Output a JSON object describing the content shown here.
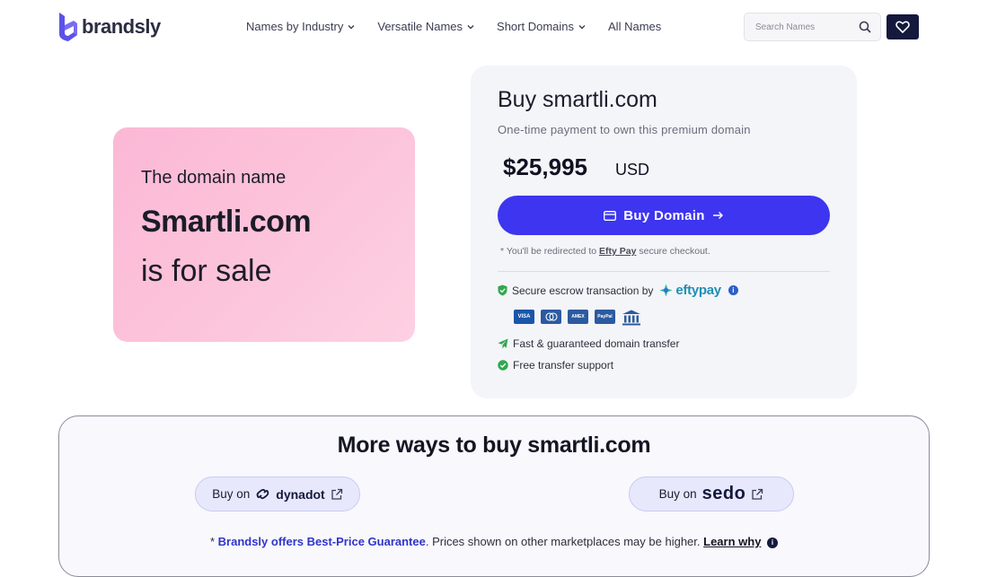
{
  "header": {
    "logo_text": "brandsly",
    "nav": [
      {
        "label": "Names by Industry",
        "has_dropdown": true
      },
      {
        "label": "Versatile Names",
        "has_dropdown": true
      },
      {
        "label": "Short Domains",
        "has_dropdown": true
      },
      {
        "label": "All Names",
        "has_dropdown": false
      }
    ],
    "search_placeholder": "Search Names",
    "icons": {
      "search": "search-icon",
      "favorites": "heart-icon"
    }
  },
  "sale_card": {
    "line1": "The domain name",
    "domain": "Smartli.com",
    "line3": "is for sale"
  },
  "buy_panel": {
    "title": "Buy smartli.com",
    "subtitle": "One-time payment to own this premium domain",
    "price": "$25,995",
    "currency": "USD",
    "buy_button": "Buy Domain",
    "redirect_prefix": "* You'll be redirected to",
    "redirect_link": "Efty Pay",
    "redirect_suffix": "secure checkout.",
    "escrow_text": "Secure escrow transaction by",
    "escrow_brand": "eftypay",
    "payment_methods": [
      "VISA",
      "MC",
      "AMEX",
      "PayPal",
      "Bank"
    ],
    "feature_transfer": "Fast & guaranteed domain transfer",
    "feature_support": "Free transfer support"
  },
  "more_ways": {
    "title": "More ways to buy smartli.com",
    "buy_on": "Buy on",
    "marketplaces": [
      "dynadot",
      "sedo"
    ],
    "guarantee_prefix": "*",
    "guarantee_brand": "Brandsly offers Best-Price Guarantee",
    "guarantee_text": ". Prices shown on other marketplaces may be higher.",
    "learn_why": "Learn why"
  },
  "colors": {
    "accent": "#3d35f0",
    "navy": "#14193d",
    "card_pink": "#fcc3da",
    "panel_bg": "#f4f5f8",
    "check_green": "#2fa84f",
    "efty_blue": "#1f8fb6"
  }
}
